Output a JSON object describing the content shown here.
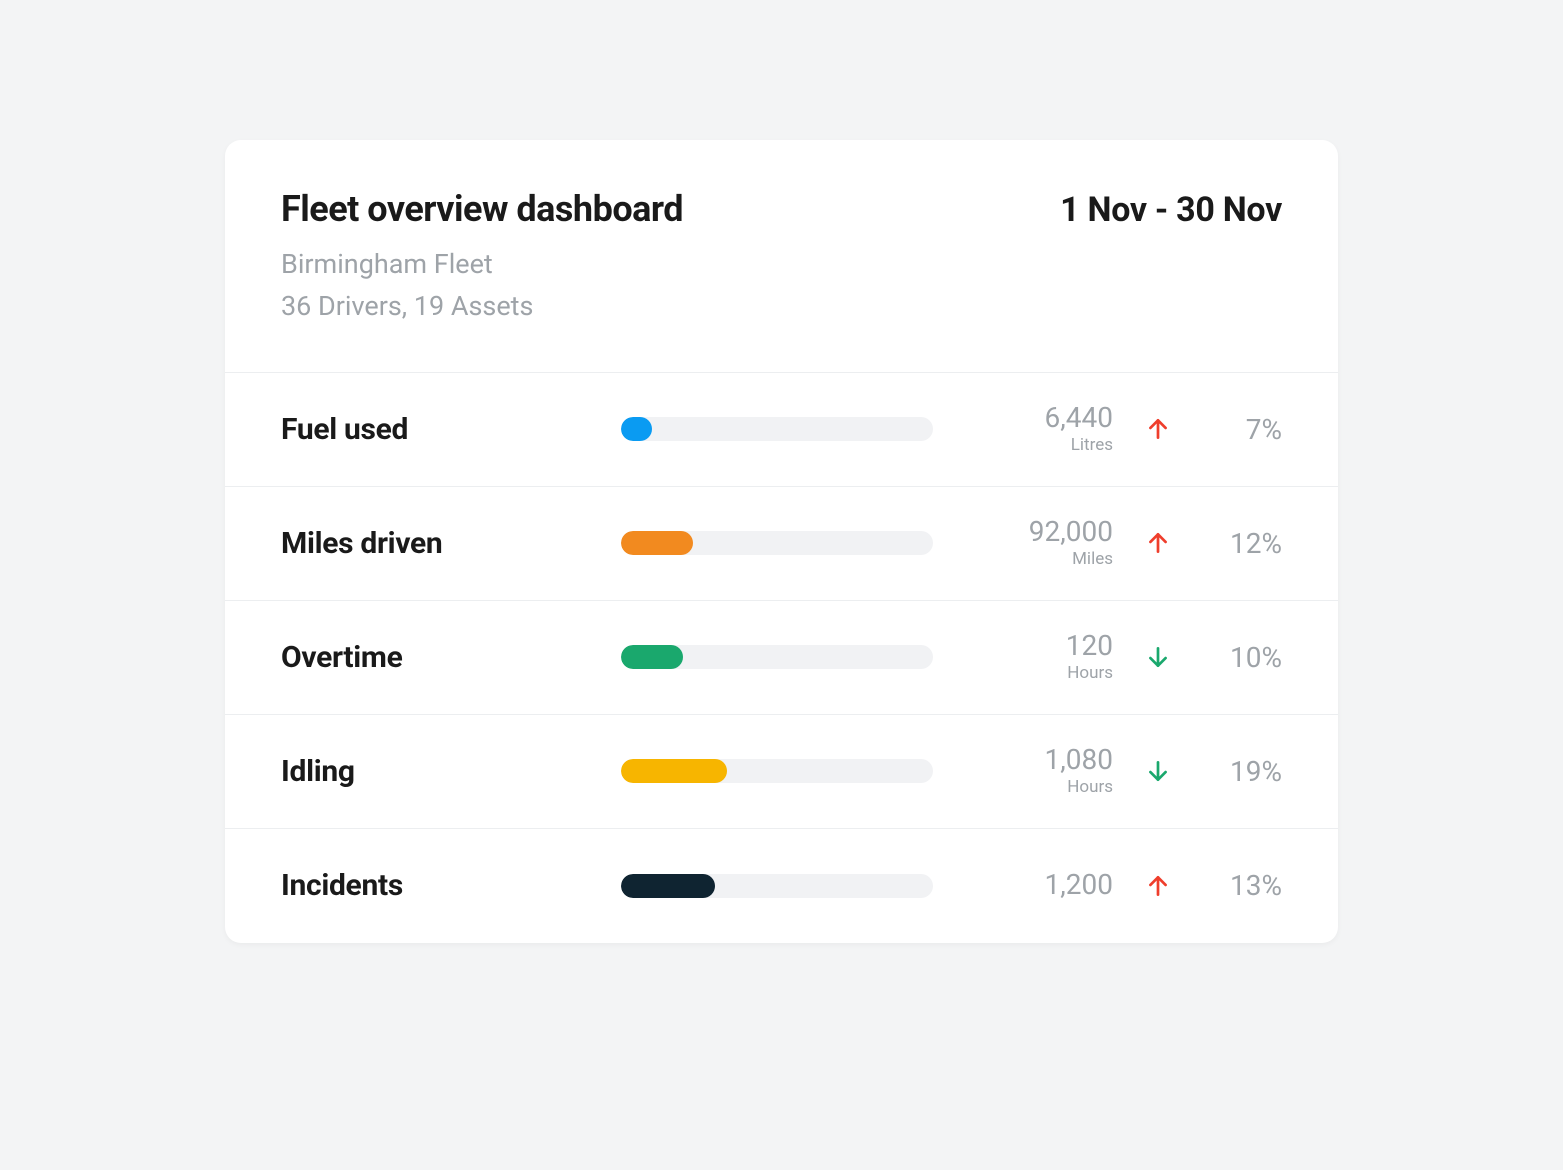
{
  "header": {
    "title": "Fleet overview dashboard",
    "fleet_name": "Birmingham Fleet",
    "stats_line": "36 Drivers, 19 Assets",
    "date_range": "1 Nov - 30 Nov"
  },
  "colors": {
    "arrow_up": "#ef3e2c",
    "arrow_down": "#1aa86d"
  },
  "metrics": [
    {
      "id": "fuel-used",
      "label": "Fuel used",
      "value": "6,440",
      "unit": "Litres",
      "bar_pct": 10,
      "bar_color": "#0a9bf2",
      "direction": "up",
      "change": "7%"
    },
    {
      "id": "miles-driven",
      "label": "Miles driven",
      "value": "92,000",
      "unit": "Miles",
      "bar_pct": 23,
      "bar_color": "#f28a1f",
      "direction": "up",
      "change": "12%"
    },
    {
      "id": "overtime",
      "label": "Overtime",
      "value": "120",
      "unit": "Hours",
      "bar_pct": 20,
      "bar_color": "#1aa86d",
      "direction": "down",
      "change": "10%"
    },
    {
      "id": "idling",
      "label": "Idling",
      "value": "1,080",
      "unit": "Hours",
      "bar_pct": 34,
      "bar_color": "#f7b500",
      "direction": "down",
      "change": "19%"
    },
    {
      "id": "incidents",
      "label": "Incidents",
      "value": "1,200",
      "unit": "",
      "bar_pct": 30,
      "bar_color": "#0f2431",
      "direction": "up",
      "change": "13%"
    }
  ]
}
